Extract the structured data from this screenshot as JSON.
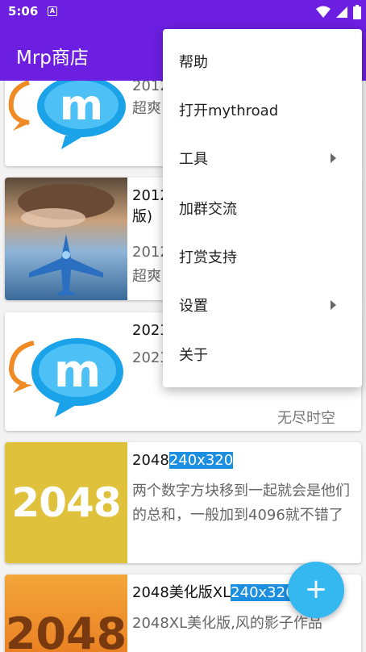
{
  "status_bar": {
    "time": "5:06",
    "a_icon": "A",
    "icons": [
      "notification-a-icon",
      "wifi-icon",
      "signal-icon",
      "battery-icon"
    ]
  },
  "app_bar": {
    "title": "Mrp商店"
  },
  "colors": {
    "primary": "#6c1fe0",
    "accent": "#35b7f0",
    "highlight": "#1d8fe0",
    "yellow_2048": "#e0c13c",
    "orange_2048": "#f08a24"
  },
  "items": [
    {
      "name_visible": "2012",
      "desc_visible": "2012",
      "desc_line2": "超爽"
    },
    {
      "name_visible": "2012",
      "name_line2": "版)",
      "desc_visible": "2012",
      "desc_line2": "超爽"
    },
    {
      "name_visible": "2023",
      "desc_visible": "2023",
      "author": "无尽时空"
    },
    {
      "name": "2048",
      "resolution": "240x320",
      "thumb_text": "2048",
      "desc": "两个数字方块移到一起就会是他们的总和，一般加到4096就不错了"
    },
    {
      "name": "2048美化版XL",
      "resolution": "240x320",
      "thumb_text": "2048",
      "desc": "2048XL美化版,风的影子作品"
    }
  ],
  "menu": {
    "items": [
      {
        "label": "帮助",
        "submenu": false
      },
      {
        "label": "打开mythroad",
        "submenu": false
      },
      {
        "label": "工具",
        "submenu": true
      },
      {
        "label": "加群交流",
        "submenu": false
      },
      {
        "label": "打赏支持",
        "submenu": false
      },
      {
        "label": "设置",
        "submenu": true
      },
      {
        "label": "关于",
        "submenu": false
      }
    ]
  },
  "fab": {
    "icon": "plus-icon",
    "label": "+"
  }
}
